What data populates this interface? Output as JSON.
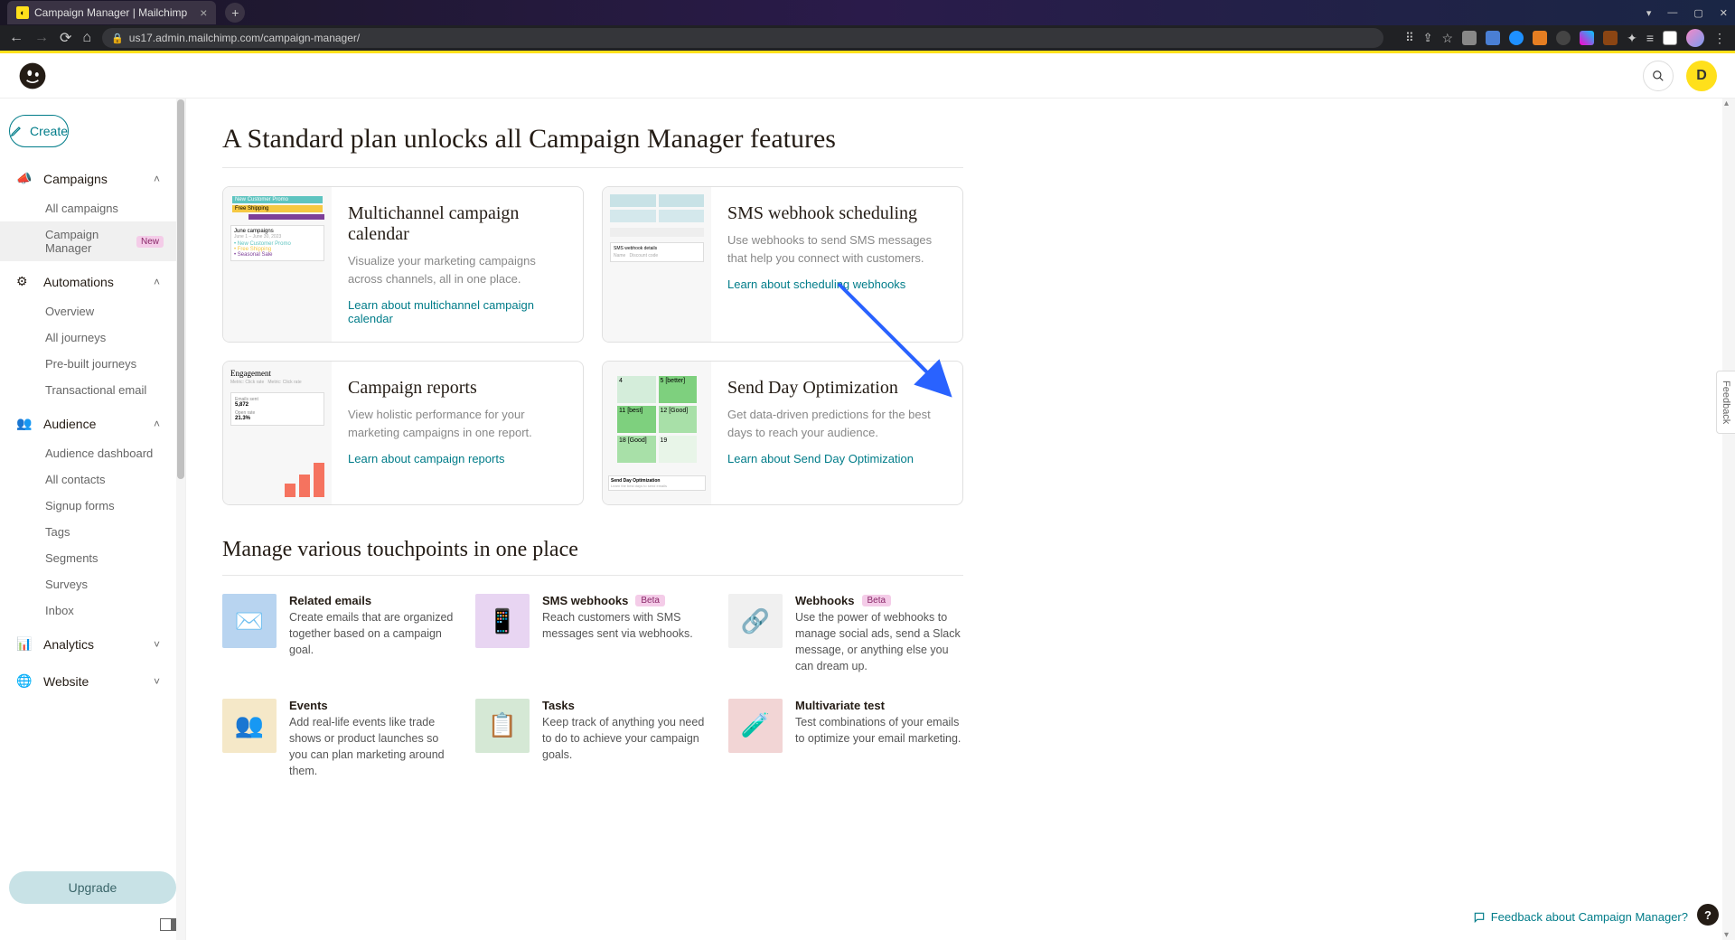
{
  "browser": {
    "tab_title": "Campaign Manager | Mailchimp",
    "url": "us17.admin.mailchimp.com/campaign-manager/"
  },
  "header": {
    "user_initial": "D"
  },
  "sidebar": {
    "create_label": "Create",
    "upgrade_label": "Upgrade",
    "sections": {
      "campaigns": {
        "label": "Campaigns",
        "items": [
          "All campaigns",
          "Campaign Manager"
        ],
        "badge": "New"
      },
      "automations": {
        "label": "Automations",
        "items": [
          "Overview",
          "All journeys",
          "Pre-built journeys",
          "Transactional email"
        ]
      },
      "audience": {
        "label": "Audience",
        "items": [
          "Audience dashboard",
          "All contacts",
          "Signup forms",
          "Tags",
          "Segments",
          "Surveys",
          "Inbox"
        ]
      },
      "analytics": {
        "label": "Analytics"
      },
      "website": {
        "label": "Website"
      }
    }
  },
  "main": {
    "heading1": "A Standard plan unlocks all Campaign Manager features",
    "features": [
      {
        "title": "Multichannel campaign calendar",
        "desc": "Visualize your marketing campaigns across channels, all in one place.",
        "link": "Learn about multichannel campaign calendar"
      },
      {
        "title": "SMS webhook scheduling",
        "desc": "Use webhooks to send SMS messages that help you connect with customers.",
        "link": "Learn about scheduling webhooks"
      },
      {
        "title": "Campaign reports",
        "desc": "View holistic performance for your marketing campaigns in one report.",
        "link": "Learn about campaign reports"
      },
      {
        "title": "Send Day Optimization",
        "desc": "Get data-driven predictions for the best days to reach your audience.",
        "link": "Learn about Send Day Optimization"
      }
    ],
    "heading2": "Manage various touchpoints in one place",
    "touchpoints": [
      {
        "title": "Related emails",
        "desc": "Create emails that are organized together based on a campaign goal.",
        "color": "#b8d4f0",
        "emoji": "✉️"
      },
      {
        "title": "SMS webhooks",
        "badge": "Beta",
        "desc": "Reach customers with SMS messages sent via webhooks.",
        "color": "#e8d5f2",
        "emoji": "📱"
      },
      {
        "title": "Webhooks",
        "badge": "Beta",
        "desc": "Use the power of webhooks to manage social ads, send a Slack message, or anything else you can dream up.",
        "color": "#f0f0f0",
        "emoji": "🔗"
      },
      {
        "title": "Events",
        "desc": "Add real-life events like trade shows or product launches so you can plan marketing around them.",
        "color": "#f5e8c8",
        "emoji": "👥"
      },
      {
        "title": "Tasks",
        "desc": "Keep track of anything you need to do to achieve your campaign goals.",
        "color": "#d5e8d5",
        "emoji": "📋"
      },
      {
        "title": "Multivariate test",
        "desc": "Test combinations of your emails to optimize your email marketing.",
        "color": "#f2d5d5",
        "emoji": "🧪"
      }
    ]
  },
  "feedback": {
    "tab": "Feedback",
    "link": "Feedback about Campaign Manager?",
    "help": "?"
  }
}
